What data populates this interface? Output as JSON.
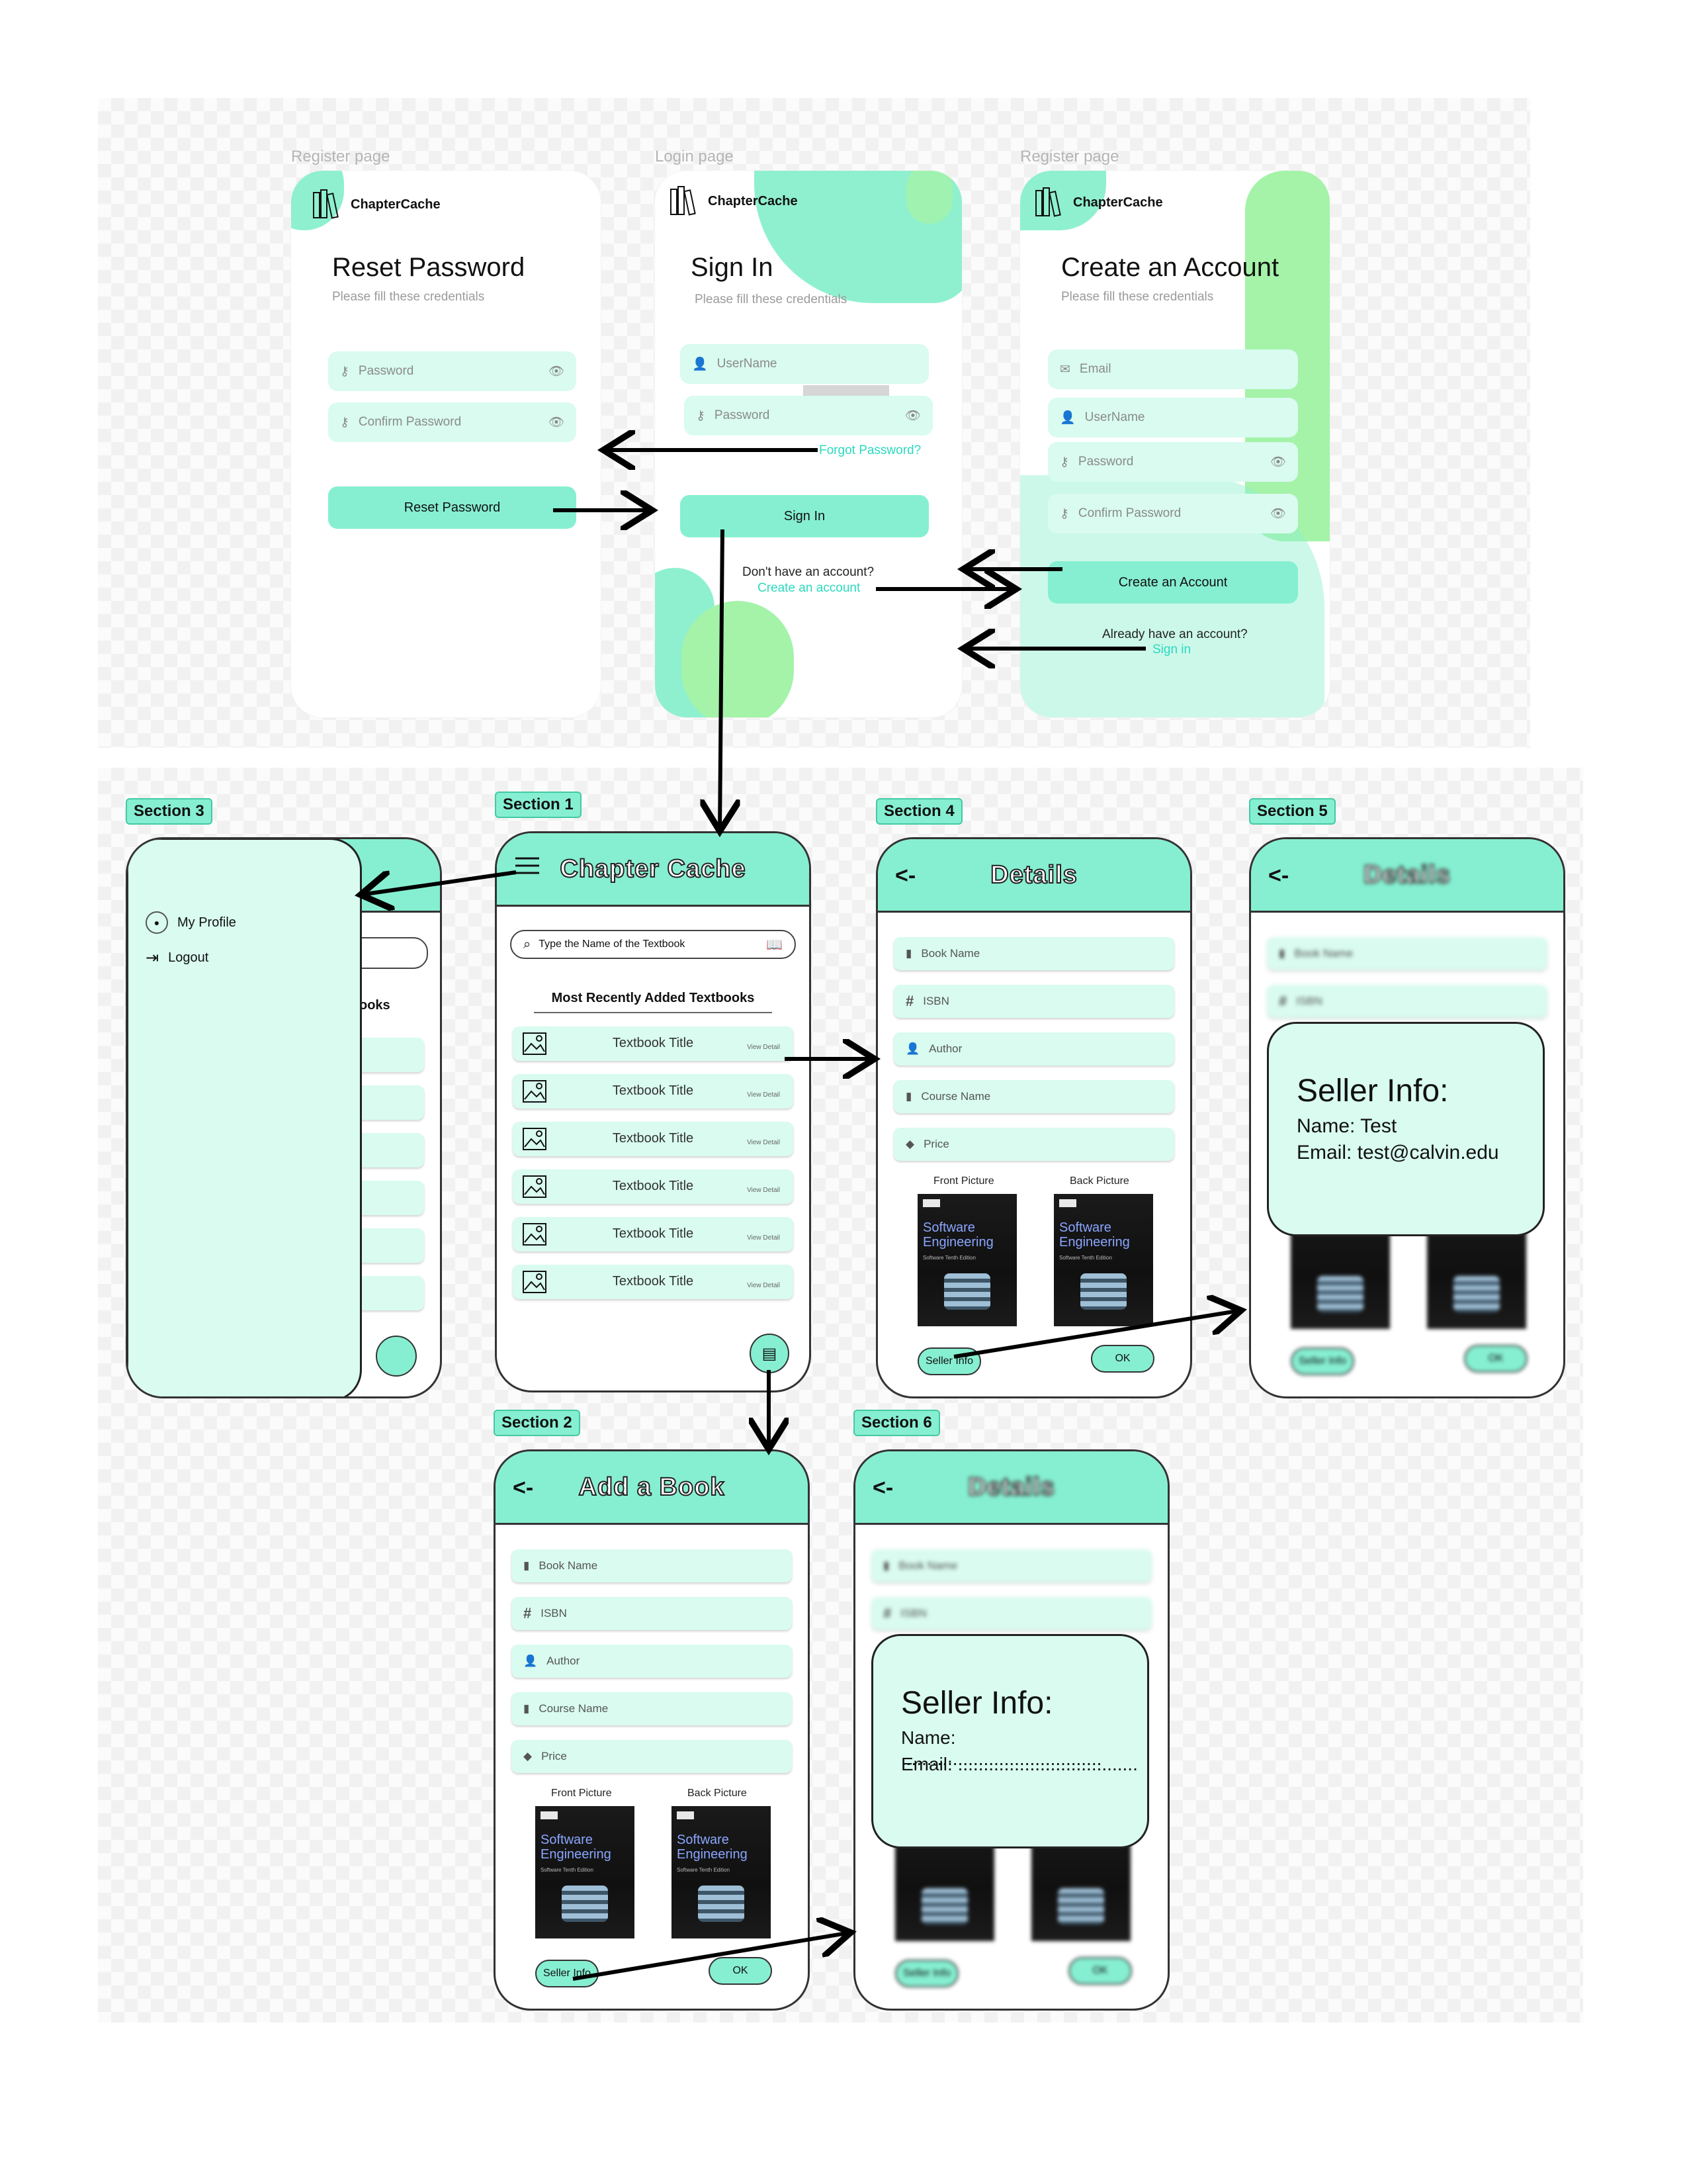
{
  "pages": {
    "reset": {
      "frame_label": "Register page",
      "brand": "ChapterCache",
      "title": "Reset Password",
      "subtitle": "Please fill these credentials",
      "password_placeholder": "Password",
      "confirm_placeholder": "Confirm Password",
      "button": "Reset Password"
    },
    "login": {
      "frame_label": "Login page",
      "brand": "ChapterCache",
      "title": "Sign In",
      "subtitle": "Please fill these credentials",
      "username_placeholder": "UserName",
      "password_placeholder": "Password",
      "forgot": "Forgot Password?",
      "button": "Sign In",
      "no_account": "Don't have an account?",
      "create_link": "Create an account"
    },
    "register": {
      "frame_label": "Register page",
      "brand": "ChapterCache",
      "title": "Create an Account",
      "subtitle": "Please fill these credentials",
      "email_placeholder": "Email",
      "username_placeholder": "UserName",
      "password_placeholder": "Password",
      "confirm_placeholder": "Confirm Password",
      "button": "Create an Account",
      "have_account": "Already have an account?",
      "signin_link": "Sign in"
    }
  },
  "sections": {
    "s1": {
      "tag": "Section 1",
      "title": "Chapter Cache",
      "search_placeholder": "Type the Name of the Textbook",
      "list_heading": "Most Recently Added Textbooks",
      "items": [
        {
          "title": "Textbook Title",
          "action": "View Detail"
        },
        {
          "title": "Textbook Title",
          "action": "View Detail"
        },
        {
          "title": "Textbook Title",
          "action": "View Detail"
        },
        {
          "title": "Textbook Title",
          "action": "View Detail"
        },
        {
          "title": "Textbook Title",
          "action": "View Detail"
        },
        {
          "title": "Textbook Title",
          "action": "View Detail"
        }
      ]
    },
    "s2": {
      "tag": "Section 2",
      "back": "<-",
      "title": "Add a Book",
      "fields": [
        "Book Name",
        "ISBN",
        "Author",
        "Course Name",
        "Price"
      ],
      "front": "Front Picture",
      "back_pic": "Back Picture",
      "seller_btn": "Seller Info",
      "ok_btn": "OK"
    },
    "s3": {
      "tag": "Section 3",
      "menu": [
        "My Profile",
        "Logout"
      ],
      "peek_heading": "ooks"
    },
    "s4": {
      "tag": "Section 4",
      "back": "<-",
      "title": "Details",
      "fields": [
        "Book Name",
        "ISBN",
        "Author",
        "Course Name",
        "Price"
      ],
      "front": "Front Picture",
      "back_pic": "Back Picture",
      "seller_btn": "Seller Info",
      "ok_btn": "OK"
    },
    "s5": {
      "tag": "Section 5",
      "back": "<-",
      "title": "Details",
      "fields": [
        "Book Name",
        "ISBN"
      ],
      "popup_title": "Seller Info:",
      "popup_name": "Name: Test",
      "popup_email": "Email: test@calvin.edu",
      "seller_btn": "Seller Info",
      "ok_btn": "OK"
    },
    "s6": {
      "tag": "Section 6",
      "back": "<-",
      "title": "Details",
      "fields": [
        "Book Name",
        "ISBN"
      ],
      "popup_title": "Seller Info:",
      "popup_name": "Name: .......................................",
      "popup_email": "Email: ...................................",
      "seller_btn": "Seller Info",
      "ok_btn": "OK"
    }
  },
  "cover": {
    "title_line1": "Software",
    "title_line2": "Engineering",
    "author": "Software Tenth Edition"
  },
  "colors": {
    "accent": "#86efd1",
    "field": "#d9fbf0",
    "link": "#2bd9bf"
  }
}
